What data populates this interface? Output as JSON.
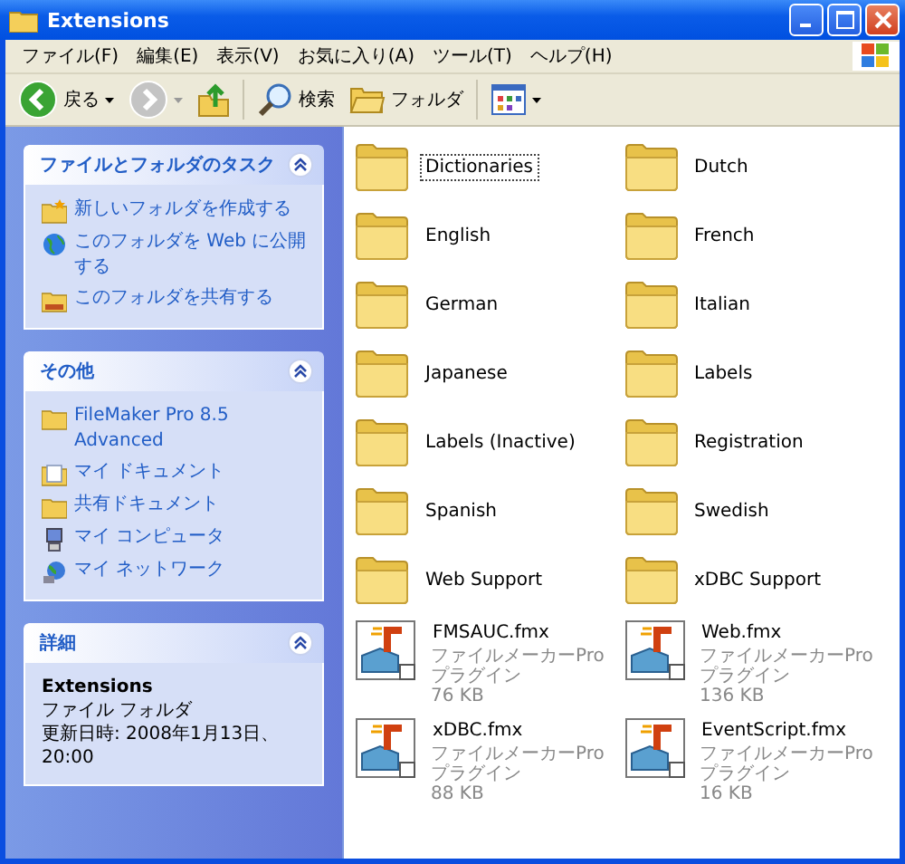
{
  "window": {
    "title": "Extensions"
  },
  "menu": [
    "ファイル(F)",
    "編集(E)",
    "表示(V)",
    "お気に入り(A)",
    "ツール(T)",
    "ヘルプ(H)"
  ],
  "toolbar": [
    {
      "kind": "back",
      "label": "戻る",
      "dropdown": true,
      "disabled": false
    },
    {
      "kind": "forward",
      "dropdown": true,
      "disabled": true
    },
    {
      "kind": "up"
    },
    {
      "kind": "search",
      "label": "検索"
    },
    {
      "kind": "folders",
      "label": "フォルダ"
    },
    {
      "kind": "views",
      "dropdown": true
    }
  ],
  "panels": [
    {
      "title": "ファイルとフォルダのタスク",
      "expanded": true,
      "items": [
        {
          "kind": "new-folder",
          "label": "新しいフォルダを作成する"
        },
        {
          "kind": "globe",
          "label": "このフォルダを Web に公開する"
        },
        {
          "kind": "share",
          "label": "このフォルダを共有する"
        }
      ]
    },
    {
      "title": "その他",
      "expanded": true,
      "items": [
        {
          "kind": "folder",
          "label": "FileMaker Pro 8.5 Advanced"
        },
        {
          "kind": "document",
          "label": "マイ ドキュメント"
        },
        {
          "kind": "folder",
          "label": "共有ドキュメント"
        },
        {
          "kind": "computer",
          "label": "マイ コンピュータ"
        },
        {
          "kind": "network",
          "label": "マイ ネットワーク"
        }
      ]
    },
    {
      "title": "詳細",
      "expanded": true,
      "details": {
        "name": "Extensions",
        "type": "ファイル フォルダ",
        "modified": "更新日時: 2008年1月13日、20:00"
      }
    }
  ],
  "items": [
    {
      "kind": "folder",
      "name": "Dictionaries",
      "selected": true
    },
    {
      "kind": "folder",
      "name": "Dutch",
      "selected": false
    },
    {
      "kind": "folder",
      "name": "English",
      "selected": false
    },
    {
      "kind": "folder",
      "name": "French",
      "selected": false
    },
    {
      "kind": "folder",
      "name": "German",
      "selected": false
    },
    {
      "kind": "folder",
      "name": "Italian",
      "selected": false
    },
    {
      "kind": "folder",
      "name": "Japanese",
      "selected": false
    },
    {
      "kind": "folder",
      "name": "Labels",
      "selected": false
    },
    {
      "kind": "folder",
      "name": "Labels (Inactive)",
      "selected": false
    },
    {
      "kind": "folder",
      "name": "Registration",
      "selected": false
    },
    {
      "kind": "folder",
      "name": "Spanish",
      "selected": false
    },
    {
      "kind": "folder",
      "name": "Swedish",
      "selected": false
    },
    {
      "kind": "folder",
      "name": "Web Support",
      "selected": false
    },
    {
      "kind": "folder",
      "name": "xDBC Support",
      "selected": false
    },
    {
      "kind": "file",
      "name": "FMSAUC.fmx",
      "type": "ファイルメーカーPro プラグイン",
      "size": "76 KB",
      "selected": false
    },
    {
      "kind": "file",
      "name": "Web.fmx",
      "type": "ファイルメーカーPro プラグイン",
      "size": "136 KB",
      "selected": false
    },
    {
      "kind": "file",
      "name": "xDBC.fmx",
      "type": "ファイルメーカーPro プラグイン",
      "size": "88 KB",
      "selected": false
    },
    {
      "kind": "file",
      "name": "EventScript.fmx",
      "type": "ファイルメーカーPro プラグイン",
      "size": "16 KB",
      "selected": false
    }
  ]
}
